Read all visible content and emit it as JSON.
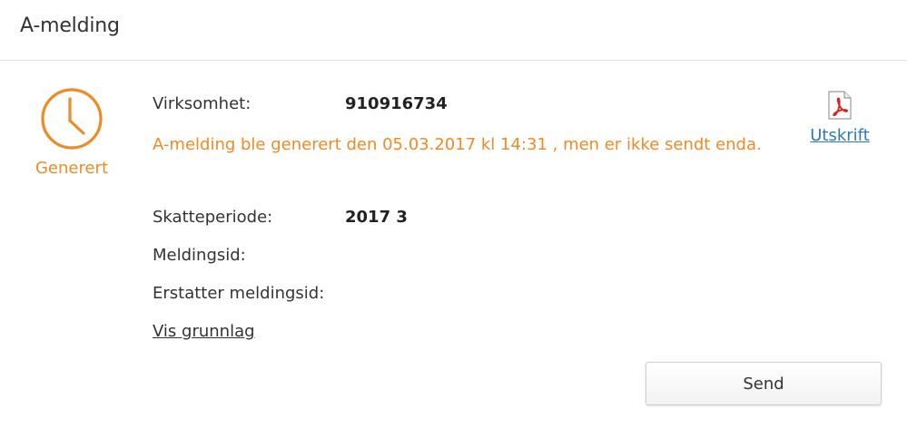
{
  "header": {
    "title": "A-melding"
  },
  "status": {
    "icon": "clock-icon",
    "label": "Generert",
    "color": "#f08a24"
  },
  "details": {
    "virksomhet_label": "Virksomhet:",
    "virksomhet_value": "910916734",
    "warning": "A-melding ble generert den 05.03.2017 kl 14:31 , men er ikke sendt enda.",
    "skatteperiode_label": "Skatteperiode:",
    "skatteperiode_value": "2017 3",
    "meldingsid_label": "Meldingsid:",
    "erstatter_label": "Erstatter meldingsid:",
    "vis_grunnlag": "Vis grunnlag"
  },
  "print": {
    "icon": "pdf-icon",
    "label": "Utskrift"
  },
  "actions": {
    "send_label": "Send"
  },
  "colors": {
    "accent_orange": "#f08a24",
    "link_blue": "#2a7ab8",
    "pdf_red": "#d9261c"
  }
}
